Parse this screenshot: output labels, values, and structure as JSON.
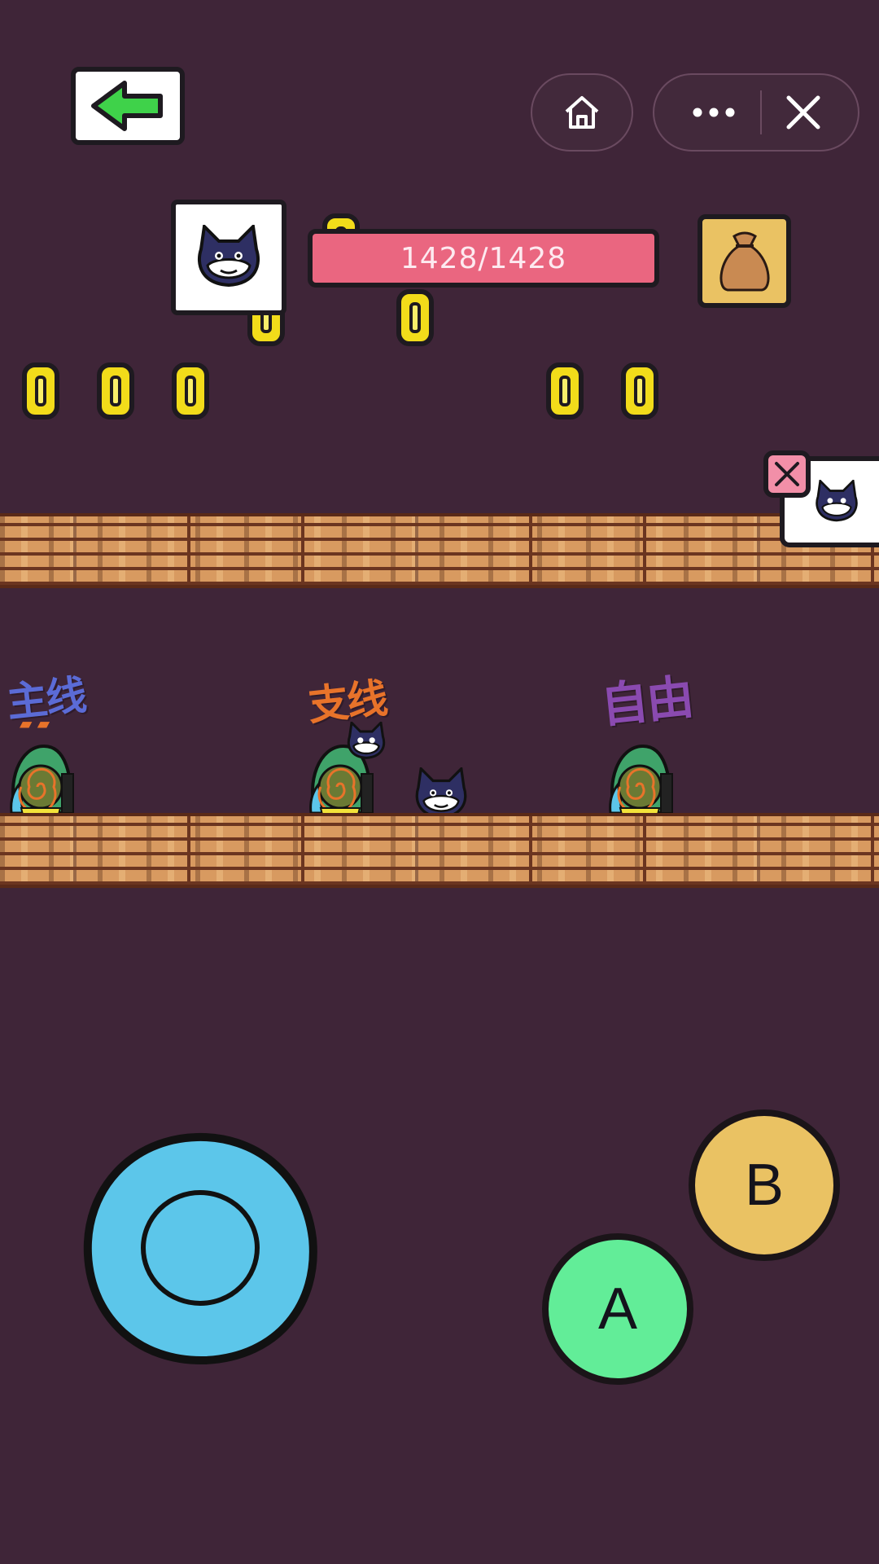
{
  "top_bar": {
    "back_icon": "green-left-arrow-icon",
    "home_icon": "home-icon",
    "more_icon": "more-dots-icon",
    "close_icon": "close-icon"
  },
  "hud": {
    "hp_text": "1428/1428",
    "hp_fraction": 1.0,
    "avatar_icon": "cat-face-icon",
    "bag_icon": "money-bag-icon"
  },
  "levels": [
    {
      "label": "主线",
      "label_color": "#5b6bd6"
    },
    {
      "label": "支线",
      "label_color": "#e8732a"
    },
    {
      "label": "自由",
      "label_color": "#8a4ab0"
    }
  ],
  "controls": {
    "a_label": "A",
    "b_label": "B"
  },
  "colors": {
    "background": "#3f2538",
    "hp_bar": "#ea6680",
    "button_a": "#62ed98",
    "button_b": "#eac263",
    "joystick": "#5cc6ea",
    "coin": "#f2dc1a"
  }
}
